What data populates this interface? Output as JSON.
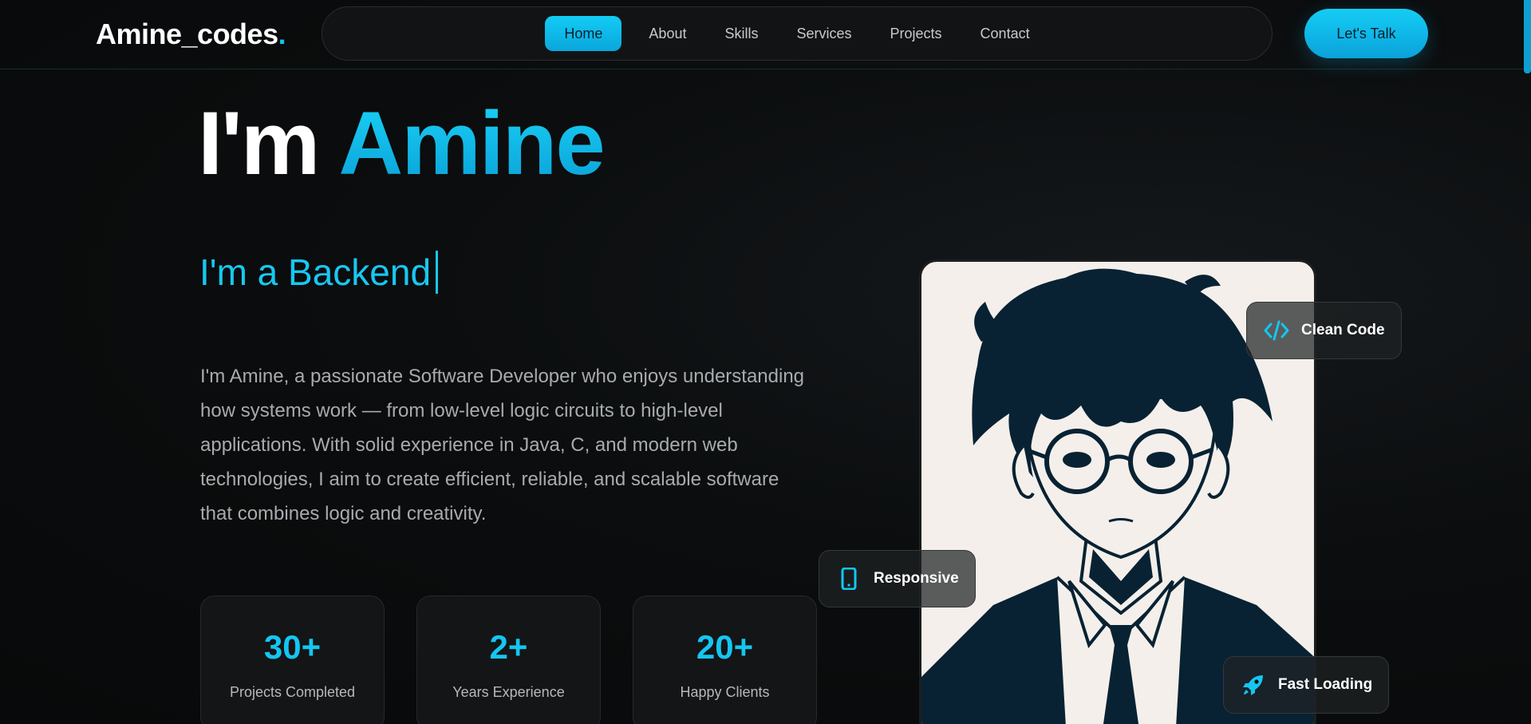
{
  "header": {
    "logo_text": "Amine_codes",
    "logo_dot": ".",
    "nav": [
      "Home",
      "About",
      "Skills",
      "Services",
      "Projects",
      "Contact"
    ],
    "active_nav": "Home",
    "cta_label": "Let's Talk"
  },
  "hero": {
    "title_prefix": "I'm",
    "title_name": "Amine",
    "typing_text": "I'm a Backend",
    "bio": "I'm Amine, a passionate Software Developer who enjoys understanding how systems work — from low-level logic circuits to high-level applications. With solid experience in Java, C, and modern web technologies, I aim to create efficient, reliable, and scalable software that combines logic and creativity.",
    "stats": [
      {
        "value": "30+",
        "label": "Projects Completed"
      },
      {
        "value": "2+",
        "label": "Years Experience"
      },
      {
        "value": "20+",
        "label": "Happy Clients"
      }
    ]
  },
  "badges": [
    {
      "label": "Clean Code",
      "icon": "code-icon"
    },
    {
      "label": "Responsive",
      "icon": "mobile-icon"
    },
    {
      "label": "Fast Loading",
      "icon": "rocket-icon"
    }
  ],
  "colors": {
    "accent": "#14c6f2",
    "background": "#0b0d0e",
    "muted_text": "#a8abae"
  }
}
